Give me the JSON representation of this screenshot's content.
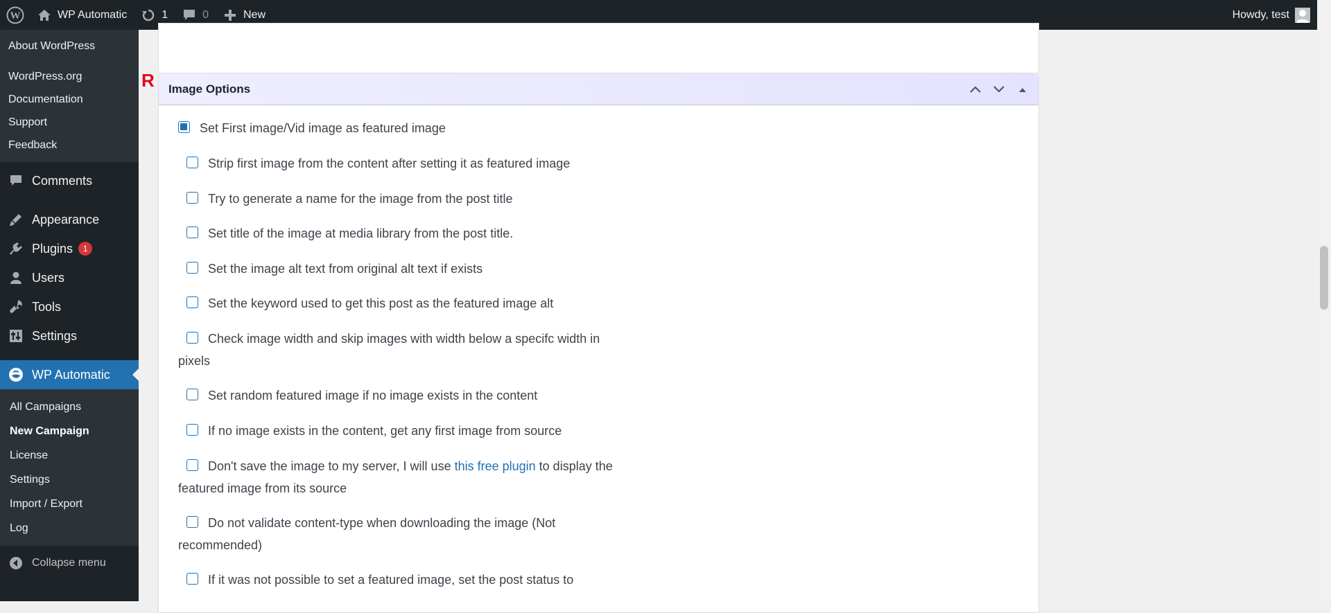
{
  "adminbar": {
    "site_name": "WP Automatic",
    "updates_count": "1",
    "comments_count": "0",
    "new_label": "New",
    "howdy": "Howdy, test"
  },
  "sidebar": {
    "wp_submenu": [
      "About WordPress",
      "WordPress.org",
      "Documentation",
      "Support",
      "Feedback"
    ],
    "menu": {
      "comments": "Comments",
      "appearance": "Appearance",
      "plugins": "Plugins",
      "plugins_badge": "1",
      "users": "Users",
      "tools": "Tools",
      "settings": "Settings",
      "wp_automatic": "WP Automatic"
    },
    "submenu": [
      "All Campaigns",
      "New Campaign",
      "License",
      "Settings",
      "Import / Export",
      "Log"
    ],
    "collapse": "Collapse menu"
  },
  "postbox": {
    "marker": "R",
    "title": "Image Options"
  },
  "options": [
    {
      "label": "Set First image/Vid image as featured image",
      "checked": true
    },
    {
      "label": "Strip first image from the content after setting it as featured image",
      "checked": false
    },
    {
      "label": "Try to generate a name for the image from the post title",
      "checked": false
    },
    {
      "label": "Set title of the image at media library from the post title.",
      "checked": false
    },
    {
      "label": "Set the image alt text from original alt text if exists",
      "checked": false
    },
    {
      "label": "Set the keyword used to get this post as the featured image alt",
      "checked": false
    },
    {
      "label": "Check image width and skip images with width below a specifc width in pixels",
      "checked": false
    },
    {
      "label": "Set random featured image if no image exists in the content",
      "checked": false
    },
    {
      "label": "If no image exists in the content, get any first image from source",
      "checked": false
    },
    {
      "label_before": "Don't save the image to my server, I will use ",
      "link": "this free plugin",
      "label_after": " to display the featured image from its source",
      "checked": false
    },
    {
      "label": "Do not validate content-type when downloading the image (Not recommended)",
      "checked": false
    },
    {
      "label": "If it was not possible to set a featured image, set the post status to",
      "checked": false
    }
  ]
}
